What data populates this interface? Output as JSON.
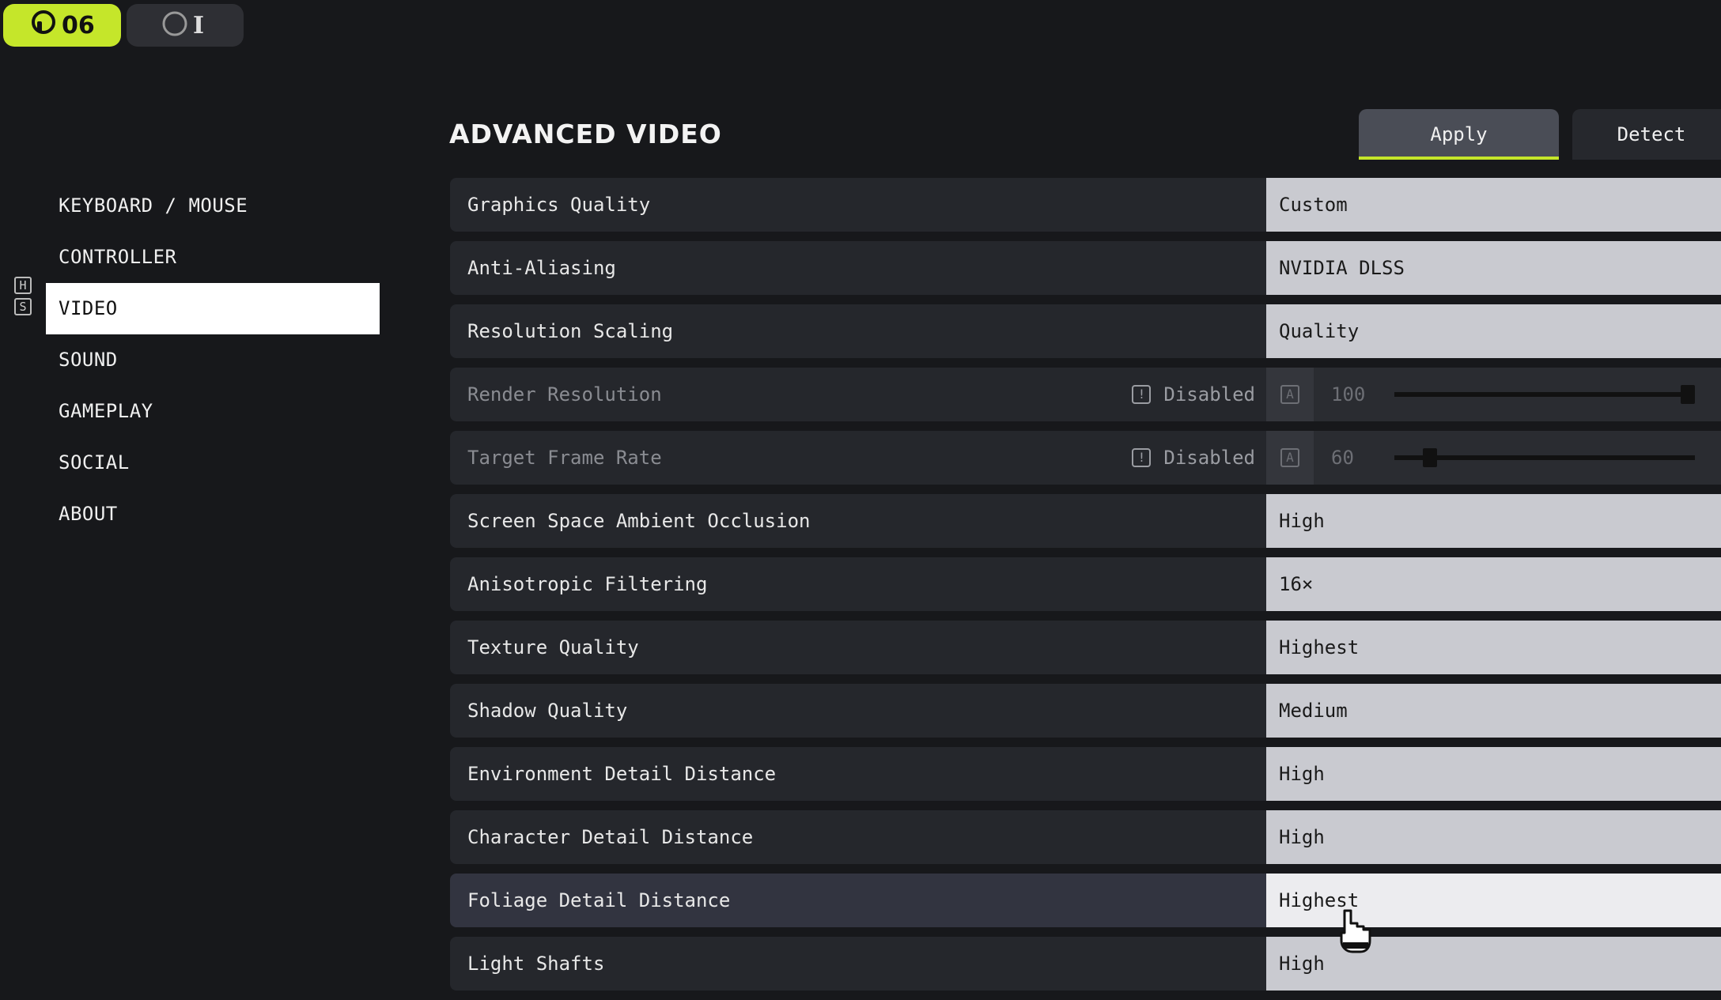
{
  "top_pills": {
    "primary_label": "06",
    "secondary_label": "I"
  },
  "sidebar": {
    "key_hints": [
      "H",
      "S"
    ],
    "items": [
      {
        "label": "KEYBOARD / MOUSE",
        "active": false
      },
      {
        "label": "CONTROLLER",
        "active": false
      },
      {
        "label": "VIDEO",
        "active": true
      },
      {
        "label": "SOUND",
        "active": false
      },
      {
        "label": "GAMEPLAY",
        "active": false
      },
      {
        "label": "SOCIAL",
        "active": false
      },
      {
        "label": "ABOUT",
        "active": false
      }
    ]
  },
  "header": {
    "title": "ADVANCED VIDEO",
    "apply_label": "Apply",
    "detect_label": "Detect"
  },
  "settings": [
    {
      "label": "Graphics Quality",
      "value": "Custom"
    },
    {
      "label": "Anti-Aliasing",
      "value": "NVIDIA DLSS"
    },
    {
      "label": "Resolution Scaling",
      "value": "Quality"
    },
    {
      "label": "Render Resolution",
      "status": "Disabled",
      "auto_key": "A",
      "slider_value": "100",
      "slider_fraction": 1.0
    },
    {
      "label": "Target Frame Rate",
      "status": "Disabled",
      "auto_key": "A",
      "slider_value": "60",
      "slider_fraction": 0.05
    },
    {
      "label": "Screen Space Ambient Occlusion",
      "value": "High"
    },
    {
      "label": "Anisotropic Filtering",
      "value": "16×"
    },
    {
      "label": "Texture Quality",
      "value": "Highest"
    },
    {
      "label": "Shadow Quality",
      "value": "Medium"
    },
    {
      "label": "Environment Detail Distance",
      "value": "High"
    },
    {
      "label": "Character Detail Distance",
      "value": "High"
    },
    {
      "label": "Foliage Detail Distance",
      "value": "Highest"
    },
    {
      "label": "Light Shafts",
      "value": "High"
    }
  ],
  "colors": {
    "accent": "#c5e62a",
    "background": "#17181b"
  }
}
